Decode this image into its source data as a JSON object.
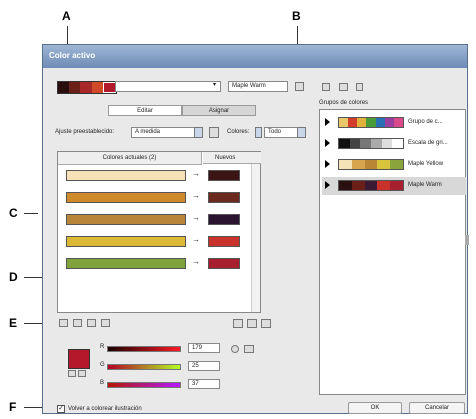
{
  "callouts": {
    "a": "A",
    "b": "B",
    "c": "C",
    "d": "D",
    "e": "E",
    "f": "F"
  },
  "dialog": {
    "title": "Color activo",
    "harmony_name": "Maple Warm",
    "tabs": [
      "Editar",
      "Asignar"
    ],
    "preset_label": "Ajuste preestablecido:",
    "preset_value": "A medida",
    "colors_label": "Colores:",
    "colors_value": "Todo",
    "col_current": "Colores actuales (2)",
    "col_new": "Nuevos",
    "rgb": {
      "r_label": "R",
      "g_label": "G",
      "b_label": "B",
      "r": "179",
      "g": "25",
      "b": "37"
    },
    "recolor_label": "Volver a colorear ilustración",
    "ok": "OK",
    "cancel": "Cancelar"
  },
  "groups_label": "Grupos de colores",
  "groups": [
    {
      "name": "Grupo de c...",
      "colors": [
        "#e8c86a",
        "#d13d2a",
        "#e2b13b",
        "#4a9c3b",
        "#2a6fb5",
        "#9a3fa0",
        "#d84a8a"
      ]
    },
    {
      "name": "Escala de gri...",
      "colors": [
        "#111111",
        "#444444",
        "#777777",
        "#aaaaaa",
        "#dddddd",
        "#ffffff"
      ]
    },
    {
      "name": "Maple Yellow",
      "colors": [
        "#f5e3b8",
        "#d6a64e",
        "#b88735",
        "#d8c33a",
        "#8aa53c"
      ]
    },
    {
      "name": "Maple Warm",
      "colors": [
        "#2a1010",
        "#6a2018",
        "#3a1a35",
        "#c8322a",
        "#a8202f"
      ]
    }
  ],
  "rows": [
    {
      "current": "#f6e2b6",
      "new": "#3b1414"
    },
    {
      "current": "#cf8a2b",
      "new": "#6a2a1e"
    },
    {
      "current": "#b7863b",
      "new": "#2b1430"
    },
    {
      "current": "#dcb934",
      "new": "#c8322a"
    },
    {
      "current": "#80a23c",
      "new": "#a8202f"
    }
  ],
  "top_swatches": [
    "#2a0e0e",
    "#6a2016",
    "#a8282a",
    "#d04a2a",
    "#b3192a"
  ],
  "active_color": "#b3192a"
}
